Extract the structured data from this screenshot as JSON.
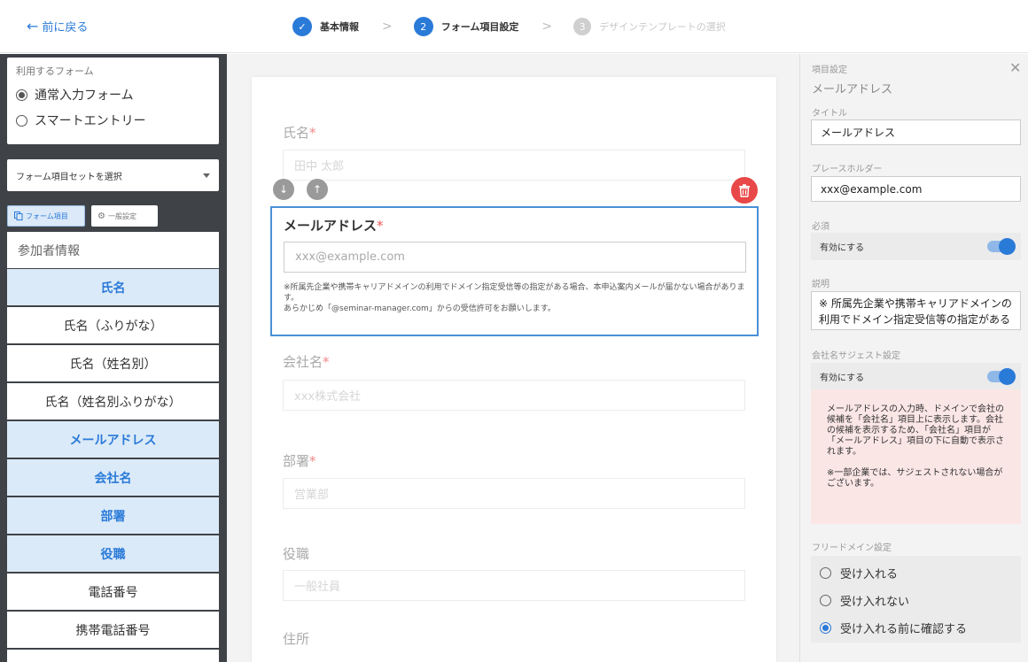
{
  "header": {
    "back_label": "前に戻る",
    "steps": [
      {
        "number": "✓",
        "label": "基本情報",
        "state": "done"
      },
      {
        "number": "2",
        "label": "フォーム項目設定",
        "state": "active"
      },
      {
        "number": "3",
        "label": "デザインテンプレートの選択",
        "state": "todo"
      }
    ]
  },
  "sidebar": {
    "form_type_label": "利用するフォーム",
    "form_types": [
      {
        "label": "通常入力フォーム",
        "selected": true
      },
      {
        "label": "スマートエントリー",
        "selected": false
      }
    ],
    "item_set_placeholder": "フォーム項目セットを選択",
    "tabs": [
      {
        "label": "フォーム項目",
        "active": true
      },
      {
        "label": "一般設定",
        "active": false
      }
    ],
    "items_header": "参加者情報",
    "items": [
      {
        "label": "氏名",
        "selected": true
      },
      {
        "label": "氏名（ふりがな）",
        "selected": false
      },
      {
        "label": "氏名（姓名別）",
        "selected": false
      },
      {
        "label": "氏名（姓名別ふりがな）",
        "selected": false
      },
      {
        "label": "メールアドレス",
        "selected": true
      },
      {
        "label": "会社名",
        "selected": true
      },
      {
        "label": "部署",
        "selected": true
      },
      {
        "label": "役職",
        "selected": true
      },
      {
        "label": "電話番号",
        "selected": false
      },
      {
        "label": "携帯電話番号",
        "selected": false
      }
    ]
  },
  "form": {
    "name": {
      "title": "氏名",
      "required": "*",
      "placeholder": "田中 太郎"
    },
    "email": {
      "title": "メールアドレス",
      "required": "*",
      "placeholder": "xxx@example.com",
      "note_line1": "※所属先企業や携帯キャリアドメインの利用でドメイン指定受信等の指定がある場合、本申込案内メールが届かない場合があります。",
      "note_line2": "あらかじめ「@seminar-manager.com」からの受信許可をお願いします。"
    },
    "company": {
      "title": "会社名",
      "required": "*",
      "placeholder": "xxx株式会社"
    },
    "department": {
      "title": "部署",
      "required": "*",
      "placeholder": "営業部"
    },
    "position": {
      "title": "役職",
      "placeholder": "一般社員"
    },
    "address": {
      "title": "住所"
    },
    "move_down_icon": "↓",
    "move_up_icon": "↑"
  },
  "settings": {
    "panel_label": "項目設定",
    "item_name": "メールアドレス",
    "title_label": "タイトル",
    "title_value": "メールアドレス",
    "placeholder_label": "プレースホルダー",
    "placeholder_value": "xxx@example.com",
    "required_label": "必須",
    "required_toggle_label": "有効にする",
    "required_enabled": true,
    "description_label": "説明",
    "description_value": "※ 所属先企業や携帯キャリアドメインの利用でドメイン指定受信等の指定がある",
    "suggest_label": "会社名サジェスト設定",
    "suggest_toggle_label": "有効にする",
    "suggest_enabled": true,
    "suggest_note_line1": "メールアドレスの入力時、ドメインで会社の候補を「会社名」項目上に表示します。会社の候補を表示するため、「会社名」項目が「メールアドレス」項目の下に自動で表示されます。",
    "suggest_note_line2": "※一部企業では、サジェストされない場合がございます。",
    "free_domain_label": "フリードメイン設定",
    "free_domain_options": [
      {
        "label": "受け入れる",
        "selected": false
      },
      {
        "label": "受け入れない",
        "selected": false
      },
      {
        "label": "受け入れる前に確認する",
        "selected": true
      }
    ],
    "close_icon": "✕"
  },
  "colors": {
    "accent": "#2a7ad8",
    "sidebar_bg": "#3f4348",
    "selected_item_bg": "#dbeaf8",
    "delete": "#e84848",
    "warning_bg": "#fbe6e6"
  }
}
